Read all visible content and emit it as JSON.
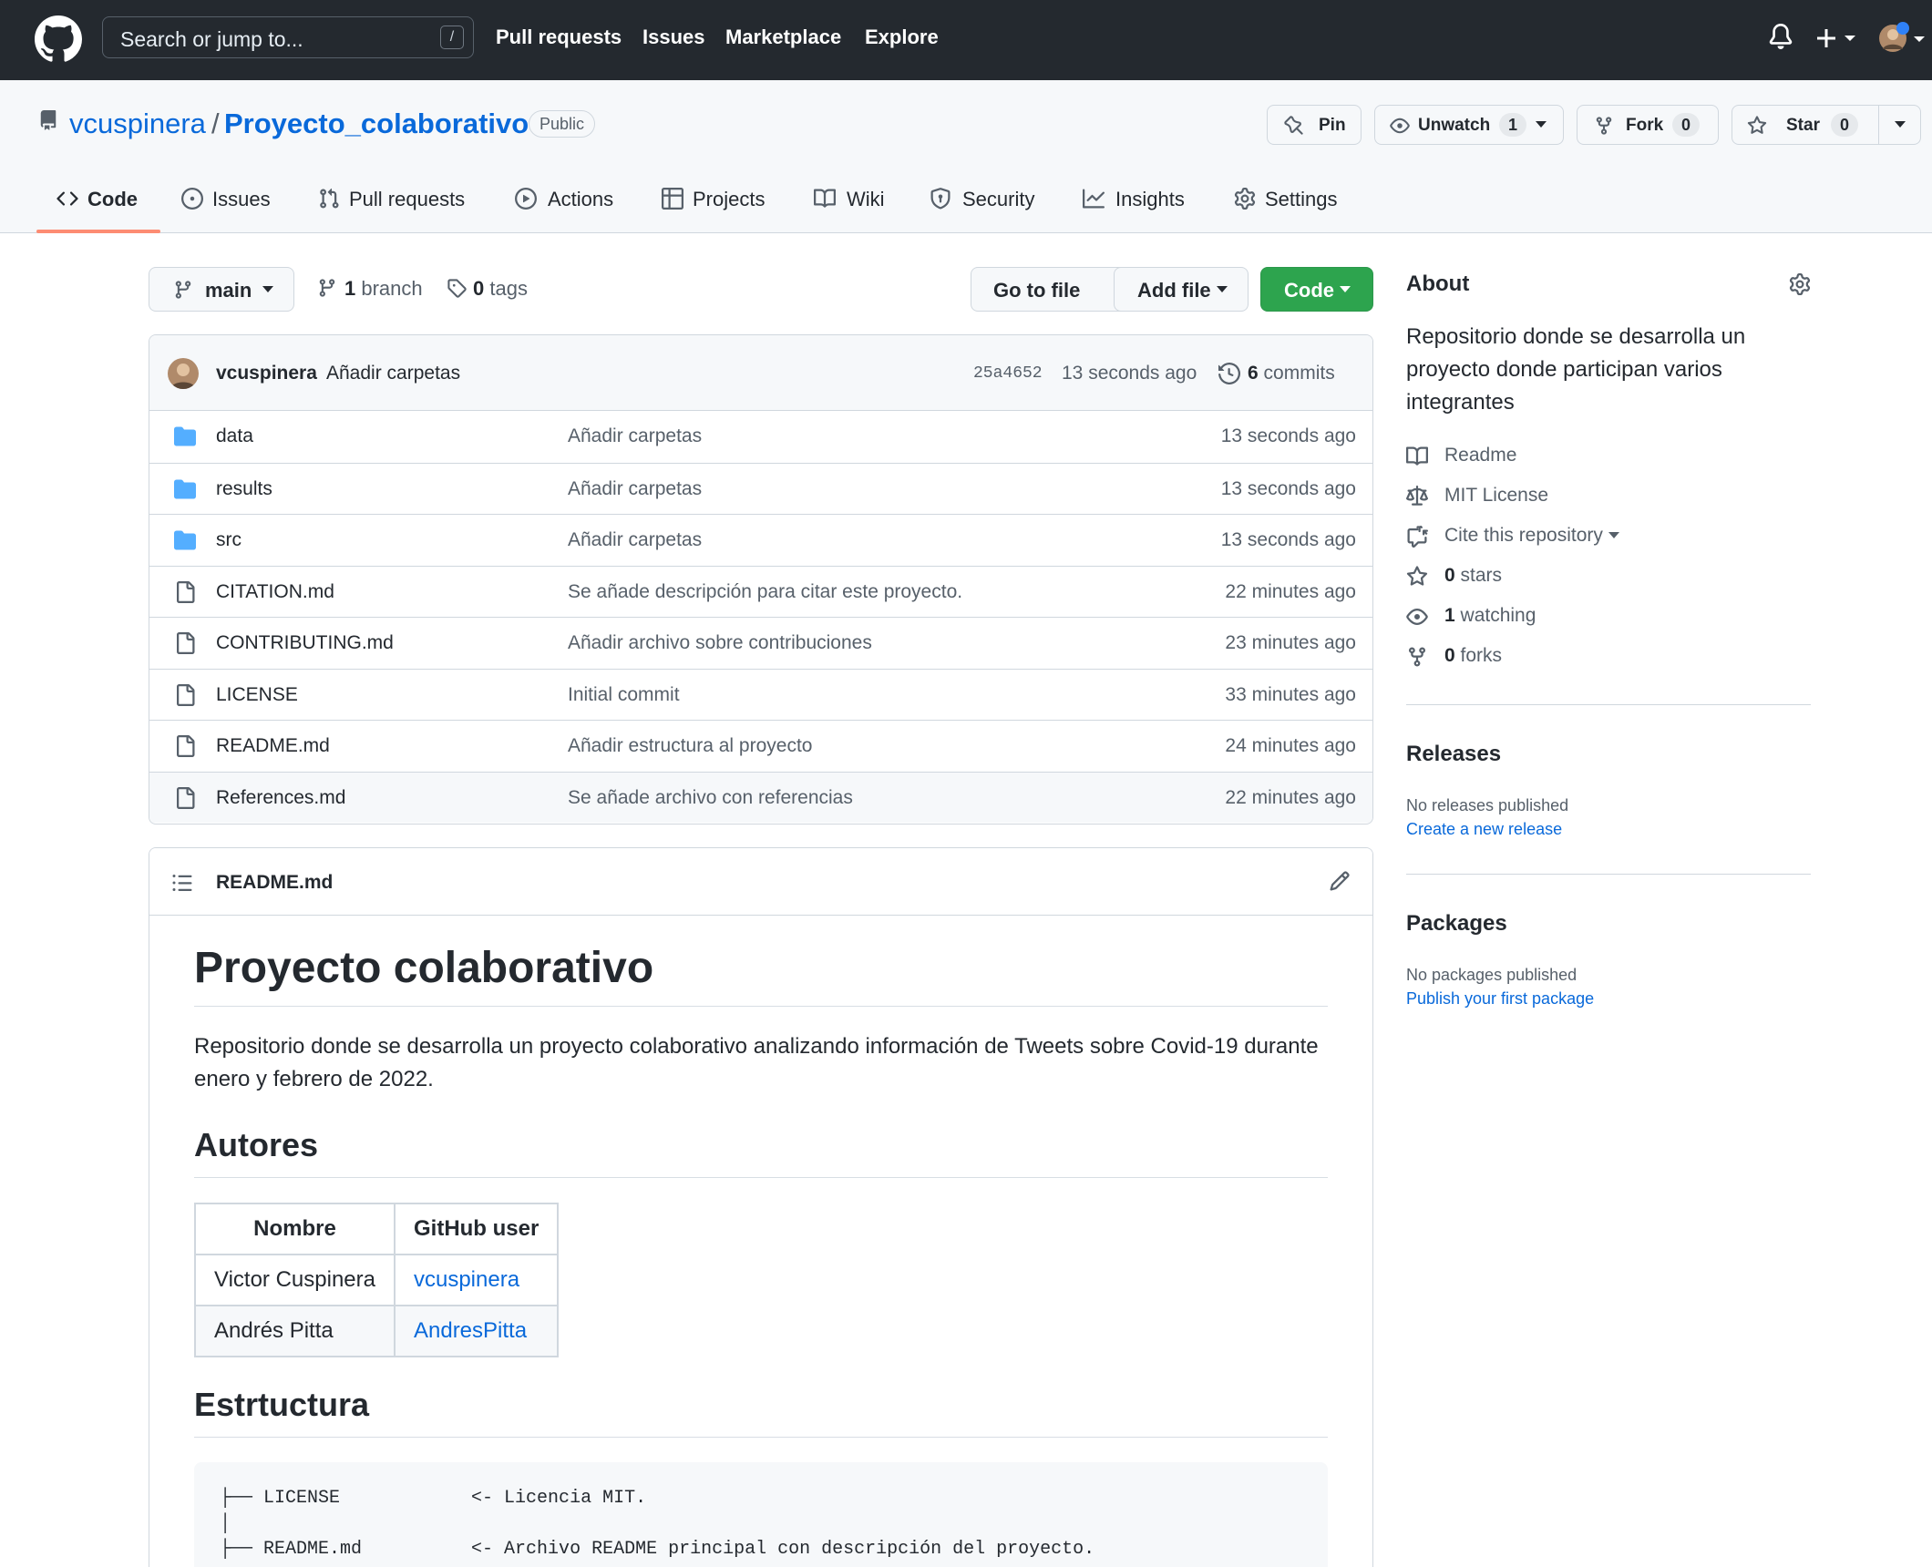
{
  "header": {
    "search_placeholder": "Search or jump to...",
    "search_shortcut": "/",
    "nav": [
      "Pull requests",
      "Issues",
      "Marketplace",
      "Explore"
    ],
    "notification_dot_color": "#2f81f7"
  },
  "repo": {
    "owner": "vcuspinera",
    "separator": "/",
    "name": "Proyecto_colaborativo",
    "visibility": "Public",
    "actions": {
      "pin": "Pin",
      "unwatch": "Unwatch",
      "watch_count": "1",
      "fork": "Fork",
      "fork_count": "0",
      "star": "Star",
      "star_count": "0"
    },
    "tabs": [
      {
        "label": "Code",
        "icon": "code-icon",
        "active": true
      },
      {
        "label": "Issues",
        "icon": "issue-icon"
      },
      {
        "label": "Pull requests",
        "icon": "pull-request-icon"
      },
      {
        "label": "Actions",
        "icon": "play-icon"
      },
      {
        "label": "Projects",
        "icon": "table-icon"
      },
      {
        "label": "Wiki",
        "icon": "book-icon"
      },
      {
        "label": "Security",
        "icon": "shield-icon"
      },
      {
        "label": "Insights",
        "icon": "graph-icon"
      },
      {
        "label": "Settings",
        "icon": "gear-icon"
      }
    ]
  },
  "branchbar": {
    "branch": "main",
    "branch_count": "1",
    "branch_label": "branch",
    "tag_count": "0",
    "tag_label": "tags",
    "go_to_file": "Go to file",
    "add_file": "Add file",
    "code": "Code"
  },
  "commit": {
    "author": "vcuspinera",
    "message": "Añadir carpetas",
    "sha": "25a4652",
    "time": "13 seconds ago",
    "count": "6",
    "count_label": "commits"
  },
  "files": [
    {
      "name": "data",
      "type": "folder",
      "message": "Añadir carpetas",
      "time": "13 seconds ago"
    },
    {
      "name": "results",
      "type": "folder",
      "message": "Añadir carpetas",
      "time": "13 seconds ago"
    },
    {
      "name": "src",
      "type": "folder",
      "message": "Añadir carpetas",
      "time": "13 seconds ago"
    },
    {
      "name": "CITATION.md",
      "type": "file",
      "message": "Se añade descripción para citar este proyecto.",
      "time": "22 minutes ago"
    },
    {
      "name": "CONTRIBUTING.md",
      "type": "file",
      "message": "Añadir archivo sobre contribuciones",
      "time": "23 minutes ago"
    },
    {
      "name": "LICENSE",
      "type": "file",
      "message": "Initial commit",
      "time": "33 minutes ago"
    },
    {
      "name": "README.md",
      "type": "file",
      "message": "Añadir estructura al proyecto",
      "time": "24 minutes ago"
    },
    {
      "name": "References.md",
      "type": "file",
      "message": "Se añade archivo con referencias",
      "time": "22 minutes ago"
    }
  ],
  "readme": {
    "filename": "README.md",
    "h1": "Proyecto colaborativo",
    "intro": "Repositorio donde se desarrolla un proyecto colaborativo analizando información de Tweets sobre Covid-19 durante enero y febrero de 2022.",
    "authors_heading": "Autores",
    "table_headers": [
      "Nombre",
      "GitHub user"
    ],
    "table_rows": [
      [
        "Victor Cuspinera",
        "vcuspinera"
      ],
      [
        "Andrés Pitta",
        "AndresPitta"
      ]
    ],
    "structure_heading": "Estrtuctura",
    "structure_lines": [
      "├── LICENSE            <- Licencia MIT.",
      "│",
      "├── README.md          <- Archivo README principal con descripción del proyecto."
    ]
  },
  "sidebar": {
    "about_heading": "About",
    "description": "Repositorio donde se desarrolla un proyecto donde participan varios integrantes",
    "readme": "Readme",
    "license": "MIT License",
    "cite": "Cite this repository",
    "stars_count": "0",
    "stars_label": "stars",
    "watching_count": "1",
    "watching_label": "watching",
    "forks_count": "0",
    "forks_label": "forks",
    "releases_heading": "Releases",
    "no_releases": "No releases published",
    "create_release": "Create a new release",
    "packages_heading": "Packages",
    "no_packages": "No packages published",
    "publish_package": "Publish your first package"
  },
  "colors": {
    "header_bg": "#24292f",
    "link": "#0969da",
    "primary_button": "#2da44e",
    "folder_icon": "#54aeff",
    "active_tab_underline": "#fd8c73"
  }
}
